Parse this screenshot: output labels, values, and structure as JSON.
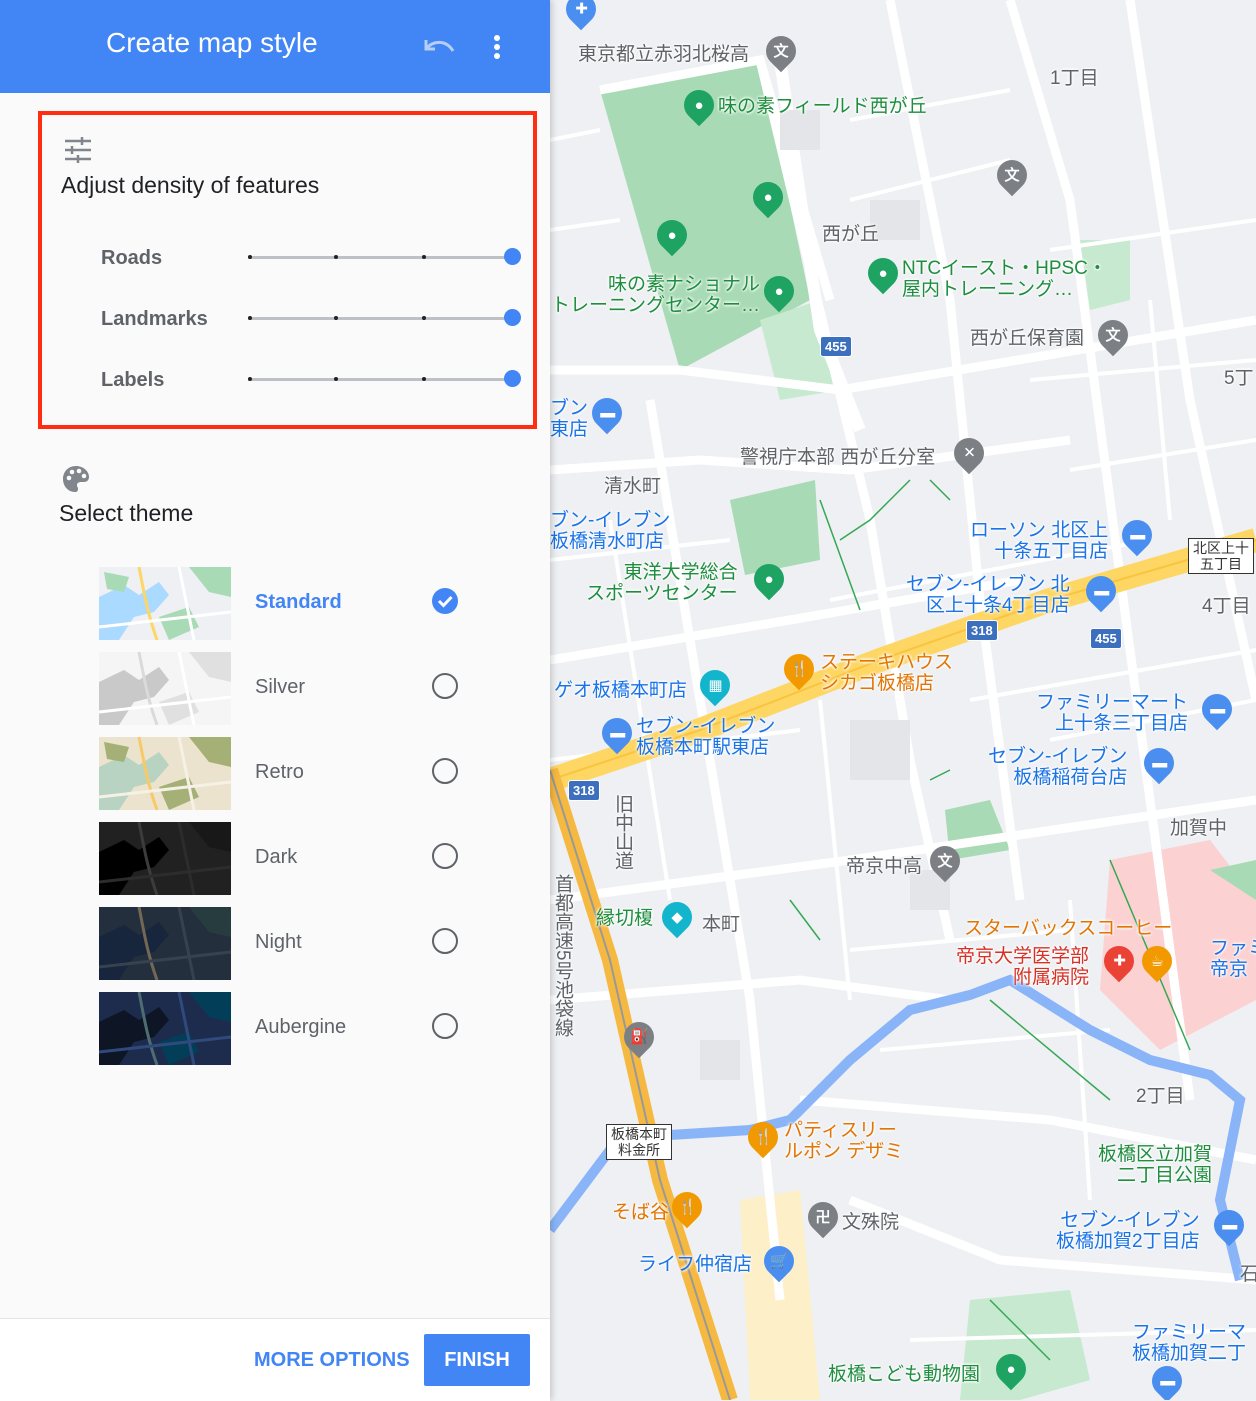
{
  "header": {
    "title": "Create map style",
    "undo_icon": "undo-icon",
    "menu_icon": "more-vert-icon",
    "background": "#4285f4"
  },
  "density": {
    "icon": "tune-icon",
    "title": "Adjust density of features",
    "highlight_color": "#ff2d12",
    "sliders": [
      {
        "label": "Roads",
        "value": 1.0
      },
      {
        "label": "Landmarks",
        "value": 1.0
      },
      {
        "label": "Labels",
        "value": 1.0
      }
    ]
  },
  "theme": {
    "icon": "palette-icon",
    "title": "Select theme",
    "options": [
      {
        "name": "Standard",
        "selected": true
      },
      {
        "name": "Silver",
        "selected": false
      },
      {
        "name": "Retro",
        "selected": false
      },
      {
        "name": "Dark",
        "selected": false
      },
      {
        "name": "Night",
        "selected": false
      },
      {
        "name": "Aubergine",
        "selected": false
      }
    ]
  },
  "footer": {
    "more_options": "MORE OPTIONS",
    "finish": "FINISH"
  },
  "map": {
    "labels": {
      "school_akabane": "東京都立赤羽北桜高",
      "ajinomoto_field": "味の素フィールド西が丘",
      "chome1": "1丁目",
      "nishigaoka": "西が丘",
      "ajinomoto_ntc": "味の素ナショナル\nトレーニングセンター…",
      "ntc_east": "NTCイースト・HPSC・\n屋内トレーニング…",
      "nursery": "西が丘保育園",
      "chome5": "5丁",
      "seven_top": "ブン\n東店",
      "police": "警視庁本部 西が丘分室",
      "shimizu": "清水町",
      "seven_shimizu": "ブン-イレブン\n板橋清水町店",
      "lawson": "ローソン 北区上\n十条五丁目店",
      "kitaku_box": "北区上十\n五丁目",
      "toyo": "東洋大学総合\nスポーツセンター",
      "seven_kamijujo": "セブン-イレブン 北\n区上十条4丁目店",
      "chome4": "4丁目",
      "steak": "ステーキハウス\nシカゴ板橋店",
      "geo": "ゲオ板橋本町店",
      "familymart_kamijujo": "ファミリーマート\n上十条三丁目店",
      "seven_honcho": "セブン-イレブン\n板橋本町駅東店",
      "seven_inaridai": "セブン-イレブン\n板橋稲荷台店",
      "kyu_nakasendo": "旧中山道",
      "kaga_school": "加賀中",
      "teikyo_high": "帝京中高",
      "expressway": "首都高速5号池袋線",
      "enkiri": "縁切榎",
      "honcho": "本町",
      "starbucks": "スターバックスコーヒー",
      "teikyo_hospital": "帝京大学医学部\n附属病院",
      "fami_right": "ファミ\n帝京",
      "chome2": "2丁目",
      "tollgate": "板橋本町\n料金所",
      "patisserie": "パティスリー\nルポン デザミ",
      "kaga_park": "板橋区立加賀\n二丁目公園",
      "soba": "そば谷",
      "monjuin": "文殊院",
      "seven_kaga": "セブン-イレブン\n板橋加賀2丁目店",
      "ishi": "石",
      "life": "ライフ仲宿店",
      "fami_kaga": "ファミリーマ\n板橋加賀二丁",
      "zoo": "板橋こども動物園"
    },
    "routes": [
      "455",
      "318",
      "455",
      "318"
    ]
  }
}
